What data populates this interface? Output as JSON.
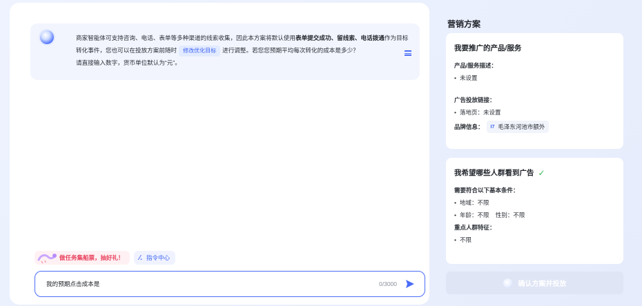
{
  "chat": {
    "message_parts": {
      "p1": "商家智能体可支持咨询、电话、表单等多种渠道的线索收集，因此本方案将默认使用",
      "p2": "表单提交成功、留线索、电话拨通",
      "p3": "作为目标转化事件，您也可以在投放方案前随时",
      "chip": "修改优化目标",
      "p4": "进行调整。若您您预期平均每次转化的成本是多少？",
      "p5": "请直接输入数字，货币单位默认为“元”。"
    },
    "shortcuts": {
      "promo": "做任务集船票，抽好礼！",
      "cmd_center": "指令中心",
      "cmd_symbol": "⁄."
    },
    "input": {
      "value": "我的预期点击成本是",
      "count": "0/3000"
    }
  },
  "plan": {
    "title": "营销方案",
    "product_card": {
      "heading": "我要推广的产品/服务",
      "desc_label": "产品/服务描述：",
      "desc_value": "未设置",
      "link_label": "广告投放链接：",
      "landing_value": "落地页：未设置",
      "brand_label": "品牌信息：",
      "brand_logo": "I7",
      "brand_name": "毛泽东河池市额外"
    },
    "audience_card": {
      "heading": "我希望哪些人群看到广告",
      "basic_label": "需要符合以下基本条件：",
      "region": "地域：不限",
      "age_gender": "年龄：不限    性别：不限",
      "key_label": "重点人群特征：",
      "key_value": "不限"
    },
    "confirm_label": "确认方案并投放"
  },
  "colors": {
    "accent": "#4a6cf7",
    "check": "#3dbb5a",
    "promo": "#e8415d"
  }
}
